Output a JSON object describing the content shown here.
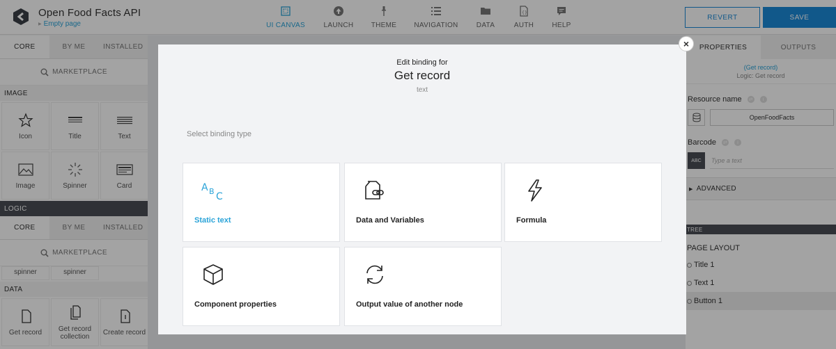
{
  "app": {
    "title": "Open Food Facts API",
    "page_selector": "Empty page"
  },
  "nav": [
    {
      "label": "UI CANVAS",
      "icon": "canvas-icon",
      "active": true
    },
    {
      "label": "LAUNCH",
      "icon": "launch-icon"
    },
    {
      "label": "THEME",
      "icon": "theme-icon"
    },
    {
      "label": "NAVIGATION",
      "icon": "navigation-icon"
    },
    {
      "label": "DATA",
      "icon": "data-folder-icon"
    },
    {
      "label": "AUTH",
      "icon": "auth-icon"
    },
    {
      "label": "HELP",
      "icon": "help-icon"
    }
  ],
  "actions": {
    "revert": "REVERT",
    "save": "SAVE"
  },
  "left": {
    "tabs": [
      "CORE",
      "BY ME",
      "INSTALLED"
    ],
    "marketplace": "MARKETPLACE",
    "image_section": "IMAGE",
    "image_tiles": [
      "Icon",
      "Title",
      "Text",
      "Image",
      "Spinner",
      "Card"
    ],
    "logic_section": "LOGIC",
    "logic_tabs": [
      "CORE",
      "BY ME",
      "INSTALLED"
    ],
    "logic_marketplace": "MARKETPLACE",
    "logic_tiles": [
      "spinner",
      "spinner"
    ],
    "data_section": "DATA",
    "data_tiles": [
      "Get record",
      "Get record collection",
      "Create record"
    ]
  },
  "right": {
    "tabs": [
      "PROPERTIES",
      "OUTPUTS"
    ],
    "node_link": "(Get record)",
    "node_logic": "Logic: Get record",
    "resource_label": "Resource name",
    "resource_value": "OpenFoodFacts",
    "barcode_label": "Barcode",
    "barcode_icon_text": "ABC",
    "barcode_placeholder": "Type a text",
    "advanced": "ADVANCED",
    "tree_header": "TREE",
    "tree_root": "PAGE LAYOUT",
    "tree_items": [
      "Title 1",
      "Text 1",
      "Button 1"
    ]
  },
  "modal": {
    "pre_title": "Edit binding for",
    "title": "Get record",
    "subtitle": "text",
    "prompt": "Select binding type",
    "close": "×",
    "cards": [
      {
        "label": "Static text",
        "icon": "abc-icon",
        "active": true
      },
      {
        "label": "Data and Variables",
        "icon": "data-variables-icon"
      },
      {
        "label": "Formula",
        "icon": "lightning-icon"
      },
      {
        "label": "Component properties",
        "icon": "cube-icon"
      },
      {
        "label": "Output value of another node",
        "icon": "refresh-cycle-icon"
      }
    ]
  },
  "colors": {
    "accent": "#1c8ad8",
    "link": "#2aa3d8",
    "dark": "#4a4e55"
  }
}
